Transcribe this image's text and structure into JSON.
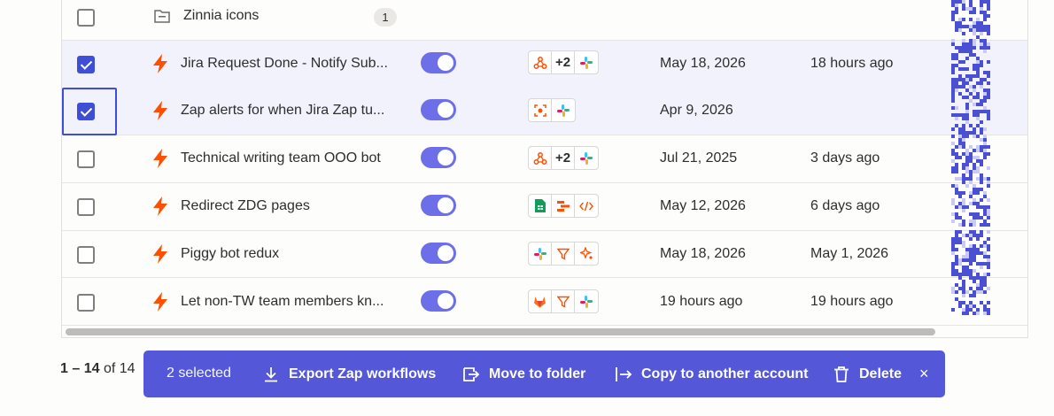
{
  "folder_row": {
    "name": "Zinnia icons",
    "count": "1"
  },
  "rows": [
    {
      "name": "Jira Request Done - Notify Sub...",
      "checked": true,
      "apps": [
        "webhook-icon",
        "+2",
        "slack-icon"
      ],
      "created": "May 18, 2026",
      "last_run": "18 hours ago"
    },
    {
      "name": "Zap alerts for when Jira Zap tu...",
      "checked": true,
      "apps": [
        "schedule-icon",
        "slack-icon"
      ],
      "created": "Apr 9, 2026",
      "last_run": ""
    },
    {
      "name": "Technical writing team OOO bot",
      "checked": false,
      "apps": [
        "webhook-icon",
        "+2",
        "slack-icon"
      ],
      "created": "Jul 21, 2025",
      "last_run": "3 days ago"
    },
    {
      "name": "Redirect ZDG pages",
      "checked": false,
      "apps": [
        "sheets-icon",
        "formatter-icon",
        "code-icon"
      ],
      "created": "May 12, 2026",
      "last_run": "6 days ago"
    },
    {
      "name": "Piggy bot redux",
      "checked": false,
      "apps": [
        "slack-icon",
        "filter-icon",
        "ai-icon"
      ],
      "created": "May 18, 2026",
      "last_run": "May 1, 2026"
    },
    {
      "name": "Let non-TW team members kn...",
      "checked": false,
      "apps": [
        "gitlab-icon",
        "filter-icon",
        "slack-icon"
      ],
      "created": "19 hours ago",
      "last_run": "19 hours ago"
    }
  ],
  "pager": {
    "range": "1 – 14",
    "of": "of 14"
  },
  "action_bar": {
    "selected": "2 selected",
    "export": "Export Zap workflows",
    "move": "Move to folder",
    "copy": "Copy to another account",
    "delete": "Delete",
    "close": "×"
  },
  "colors": {
    "accent": "#5457d8",
    "bolt": "#ff4f00",
    "toggle": "#6c6fe8",
    "selected_row": "#f1f2fb"
  }
}
